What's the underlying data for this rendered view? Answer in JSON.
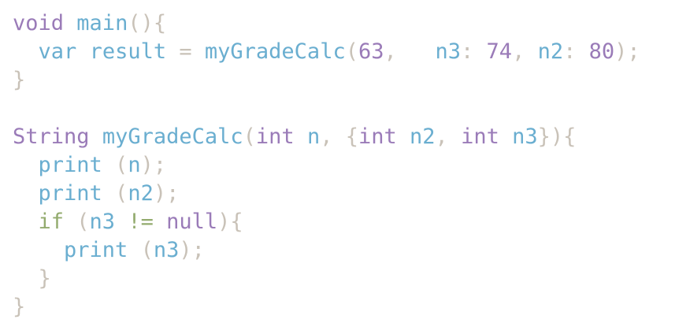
{
  "editor": {
    "colors": {
      "keyword": "#9a7bb8",
      "identifier": "#6aaed0",
      "number": "#9a7bb8",
      "punctuation": "#c9c2b8",
      "control": "#93ab6e"
    },
    "lines": [
      [
        [
          "void",
          "keyword"
        ],
        [
          " ",
          "space"
        ],
        [
          "main",
          "identifier"
        ],
        [
          "(){",
          "punctuation"
        ]
      ],
      [
        [
          "  ",
          "space"
        ],
        [
          "var",
          "identifier"
        ],
        [
          " ",
          "space"
        ],
        [
          "result",
          "identifier"
        ],
        [
          " = ",
          "punctuation"
        ],
        [
          "myGradeCalc",
          "identifier"
        ],
        [
          "(",
          "punctuation"
        ],
        [
          "63",
          "number"
        ],
        [
          ",   ",
          "punctuation"
        ],
        [
          "n3",
          "identifier"
        ],
        [
          ": ",
          "punctuation"
        ],
        [
          "74",
          "number"
        ],
        [
          ", ",
          "punctuation"
        ],
        [
          "n2",
          "identifier"
        ],
        [
          ": ",
          "punctuation"
        ],
        [
          "80",
          "number"
        ],
        [
          ");",
          "punctuation"
        ]
      ],
      [
        [
          "}",
          "punctuation"
        ]
      ],
      [],
      [
        [
          "String",
          "keyword"
        ],
        [
          " ",
          "space"
        ],
        [
          "myGradeCalc",
          "identifier"
        ],
        [
          "(",
          "punctuation"
        ],
        [
          "int",
          "keyword"
        ],
        [
          " ",
          "space"
        ],
        [
          "n",
          "identifier"
        ],
        [
          ", {",
          "punctuation"
        ],
        [
          "int",
          "keyword"
        ],
        [
          " ",
          "space"
        ],
        [
          "n2",
          "identifier"
        ],
        [
          ", ",
          "punctuation"
        ],
        [
          "int",
          "keyword"
        ],
        [
          " ",
          "space"
        ],
        [
          "n3",
          "identifier"
        ],
        [
          "}){",
          "punctuation"
        ]
      ],
      [
        [
          "  ",
          "space"
        ],
        [
          "print",
          "identifier"
        ],
        [
          " (",
          "punctuation"
        ],
        [
          "n",
          "identifier"
        ],
        [
          ");",
          "punctuation"
        ]
      ],
      [
        [
          "  ",
          "space"
        ],
        [
          "print",
          "identifier"
        ],
        [
          " (",
          "punctuation"
        ],
        [
          "n2",
          "identifier"
        ],
        [
          ");",
          "punctuation"
        ]
      ],
      [
        [
          "  ",
          "space"
        ],
        [
          "if",
          "control"
        ],
        [
          " (",
          "punctuation"
        ],
        [
          "n3",
          "identifier"
        ],
        [
          " ",
          "space"
        ],
        [
          "!=",
          "control"
        ],
        [
          " ",
          "space"
        ],
        [
          "null",
          "keyword"
        ],
        [
          "){",
          "punctuation"
        ]
      ],
      [
        [
          "    ",
          "space"
        ],
        [
          "print",
          "identifier"
        ],
        [
          " (",
          "punctuation"
        ],
        [
          "n3",
          "identifier"
        ],
        [
          ");",
          "punctuation"
        ]
      ],
      [
        [
          "  ",
          "space"
        ],
        [
          "}",
          "punctuation"
        ]
      ],
      [
        [
          "}",
          "punctuation"
        ]
      ]
    ]
  }
}
